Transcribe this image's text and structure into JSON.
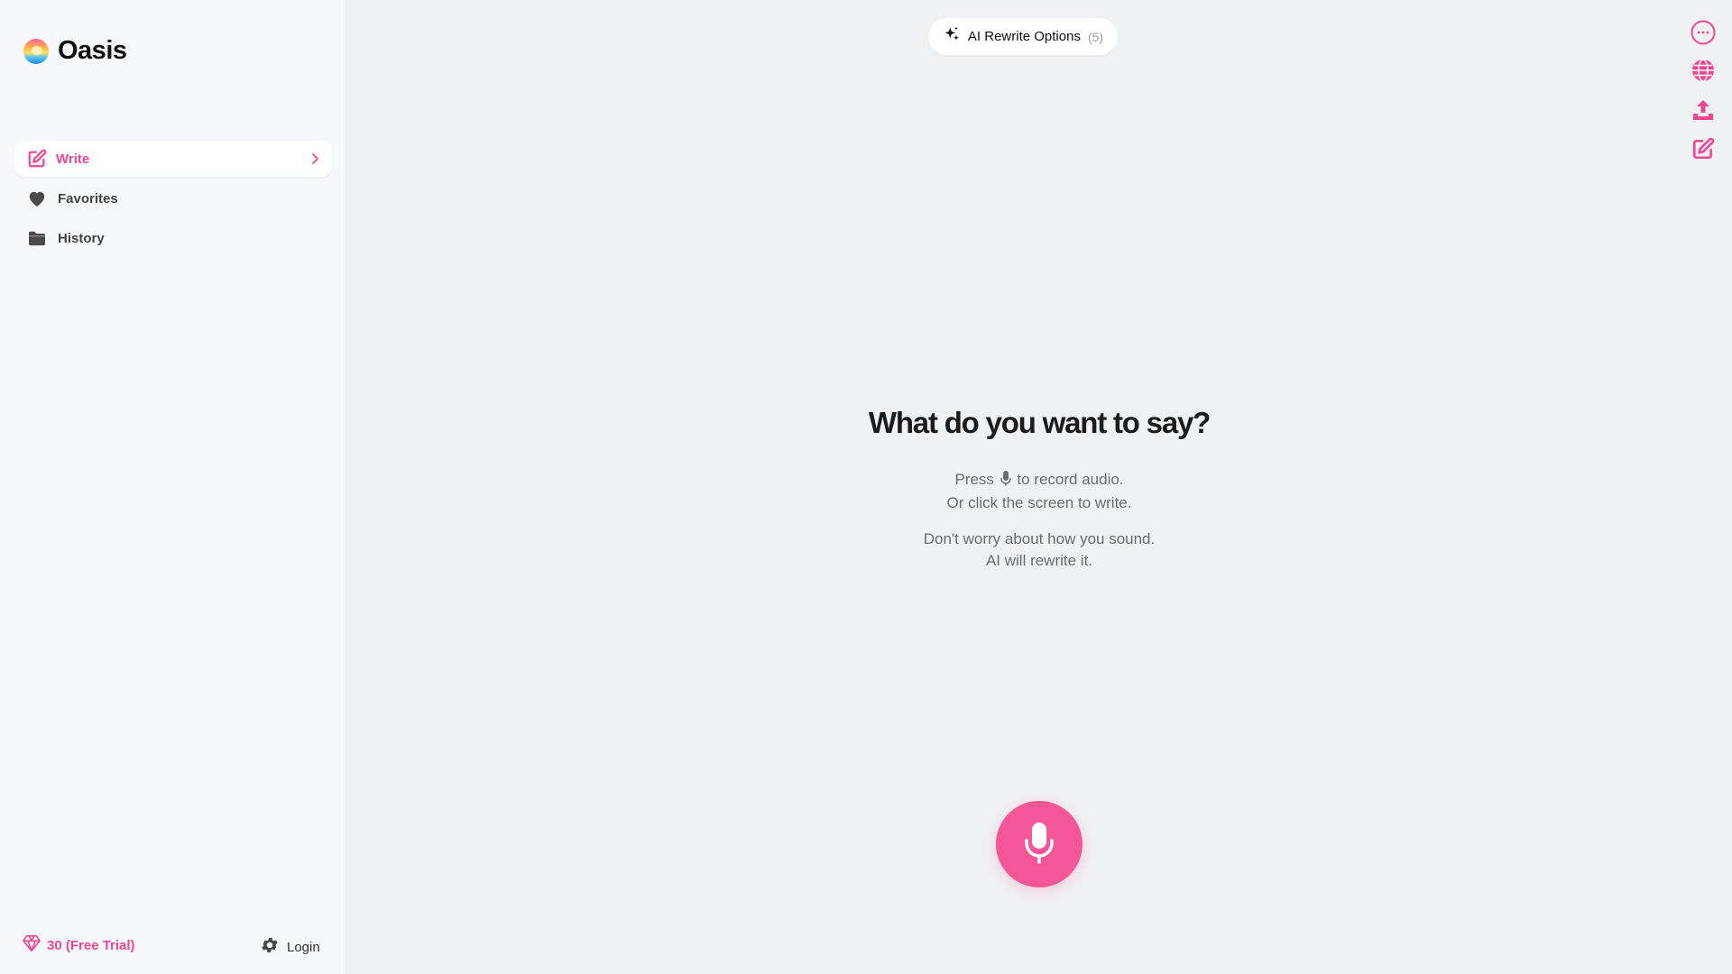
{
  "app": {
    "name": "Oasis"
  },
  "sidebar": {
    "items": [
      {
        "label": "Write",
        "icon": "pencil-square-icon"
      },
      {
        "label": "Favorites",
        "icon": "heart-icon"
      },
      {
        "label": "History",
        "icon": "folder-icon"
      }
    ],
    "credits": {
      "text": "30 (Free Trial)",
      "icon": "gem-icon"
    },
    "login": {
      "text": "Login",
      "icon": "gear-icon"
    }
  },
  "header": {
    "ai_rewrite": {
      "label": "AI Rewrite Options",
      "count": "(5)",
      "icon": "sparkles-icon"
    }
  },
  "toolbar": {
    "icons": [
      "more-icon",
      "globe-icon",
      "upload-icon",
      "new-note-icon"
    ]
  },
  "main": {
    "headline": "What do you want to say?",
    "hint1": {
      "pre": "Press",
      "post": "to record audio.",
      "line2": "Or click the screen to write."
    },
    "hint2": {
      "line1": "Don't worry about how you sound.",
      "line2": "AI will rewrite it."
    }
  },
  "colors": {
    "accent": "#f0458f",
    "mic": "#f35797",
    "sidebar_bg": "#f7f8fb",
    "page_bg": "#f0f1f3"
  }
}
